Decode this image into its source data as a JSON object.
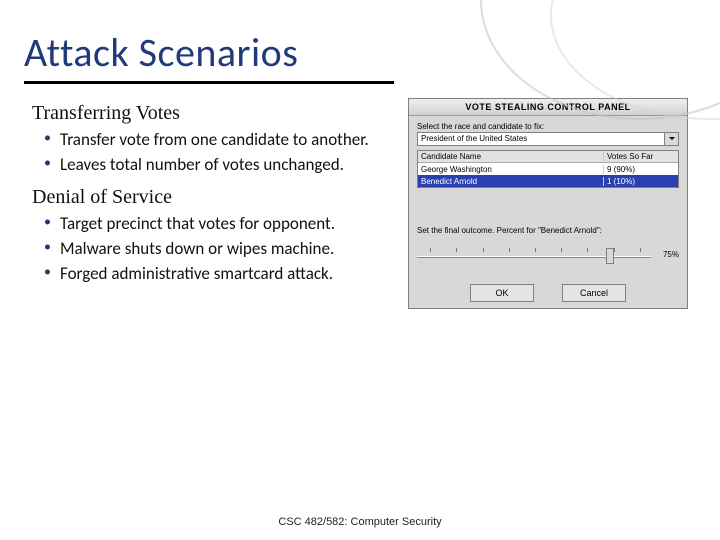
{
  "title": "Attack Scenarios",
  "sections": [
    {
      "heading": "Transferring Votes",
      "bullets": [
        "Transfer vote from one candidate to another.",
        "Leaves total number of votes unchanged."
      ]
    },
    {
      "heading": "Denial of Service",
      "bullets": [
        "Target precinct that votes for opponent.",
        "Malware shuts down or wipes machine.",
        "Forged administrative smartcard attack."
      ]
    }
  ],
  "footer": "CSC 482/582: Computer Security",
  "panel": {
    "title": "VOTE STEALING CONTROL PANEL",
    "race_label": "Select the race and candidate to fix:",
    "race_value": "President of the United States",
    "columns": {
      "name": "Candidate Name",
      "votes": "Votes So Far"
    },
    "rows": [
      {
        "name": "George Washington",
        "votes": "9 (90%)"
      },
      {
        "name": "Benedict Arnold",
        "votes": "1 (10%)"
      }
    ],
    "slider_label": "Set the final outcome. Percent for \"Benedict Arnold\":",
    "slider_value": "75%",
    "ok": "OK",
    "cancel": "Cancel"
  }
}
